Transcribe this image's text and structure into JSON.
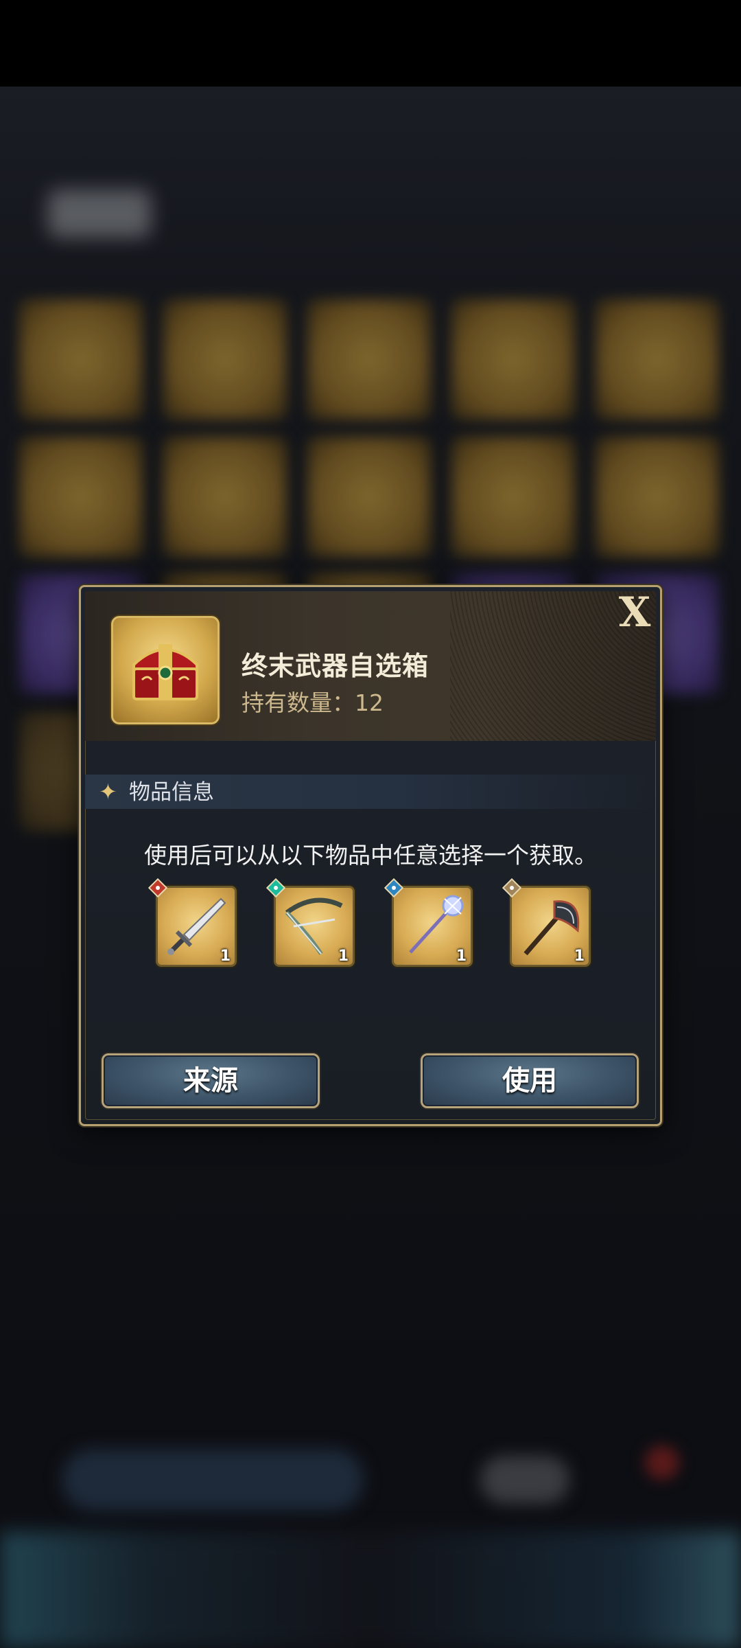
{
  "dialog": {
    "item_name": "终末武器自选箱",
    "count_label": "持有数量：",
    "count_value": "12",
    "close_label": "X",
    "section_title": "物品信息",
    "description": "使用后可以从以下物品中任意选择一个获取。",
    "rewards": [
      {
        "icon": "greatsword-icon",
        "element": "fire-element-icon",
        "element_color": "#c0392b",
        "qty": "1"
      },
      {
        "icon": "bow-icon",
        "element": "wind-element-icon",
        "element_color": "#1abc9c",
        "qty": "1"
      },
      {
        "icon": "staff-icon",
        "element": "water-element-icon",
        "element_color": "#2e86c1",
        "qty": "1"
      },
      {
        "icon": "axe-icon",
        "element": "earth-element-icon",
        "element_color": "#a0845c",
        "qty": "1"
      }
    ],
    "buttons": {
      "source": "来源",
      "use": "使用"
    }
  },
  "colors": {
    "accent_gold": "#b8a170",
    "button_blue": "#3d5468"
  }
}
